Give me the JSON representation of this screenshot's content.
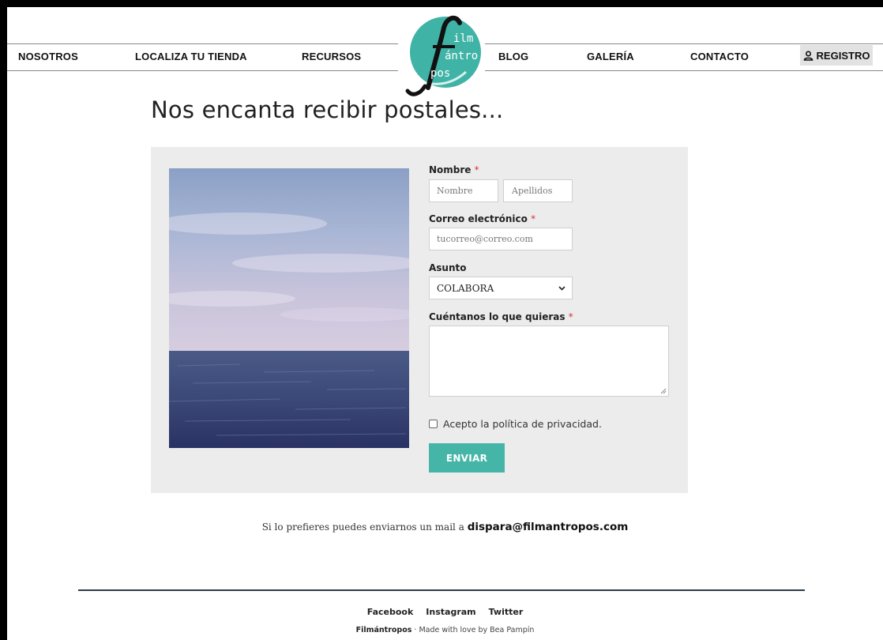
{
  "nav": {
    "items": [
      "NOSOTROS",
      "LOCALIZA TU TIENDA",
      "RECURSOS",
      "BLOG",
      "GALERÍA",
      "CONTACTO"
    ],
    "register": "REGISTRO",
    "register_icon": "user-icon"
  },
  "logo": {
    "line1": "ilm",
    "line2": "ántro",
    "line3": "pos",
    "letter": "f",
    "color": "#3fb3a6"
  },
  "main": {
    "title": "Nos encanta recibir postales..."
  },
  "form": {
    "name_label": "Nombre",
    "first_name_placeholder": "Nombre",
    "last_name_placeholder": "Apellidos",
    "email_label": "Correo electrónico",
    "email_placeholder": "tucorreo@correo.com",
    "subject_label": "Asunto",
    "subject_value": "COLABORA",
    "message_label": "Cuéntanos lo que quieras",
    "required_mark": "*",
    "privacy_label": "Acepto la política de privacidad.",
    "submit": "ENVIAR"
  },
  "contact": {
    "text": "Si lo prefieres puedes enviarnos un mail a",
    "email": "dispara@filmantropos.com"
  },
  "footer": {
    "links": [
      "Facebook",
      "Instagram",
      "Twitter"
    ],
    "brand": "Filmántropos",
    "credit": " · Made with love by Bea Pampín"
  },
  "colors": {
    "accent": "#45b5a8",
    "panel": "#ececec",
    "footer_line": "#2b3b47"
  }
}
